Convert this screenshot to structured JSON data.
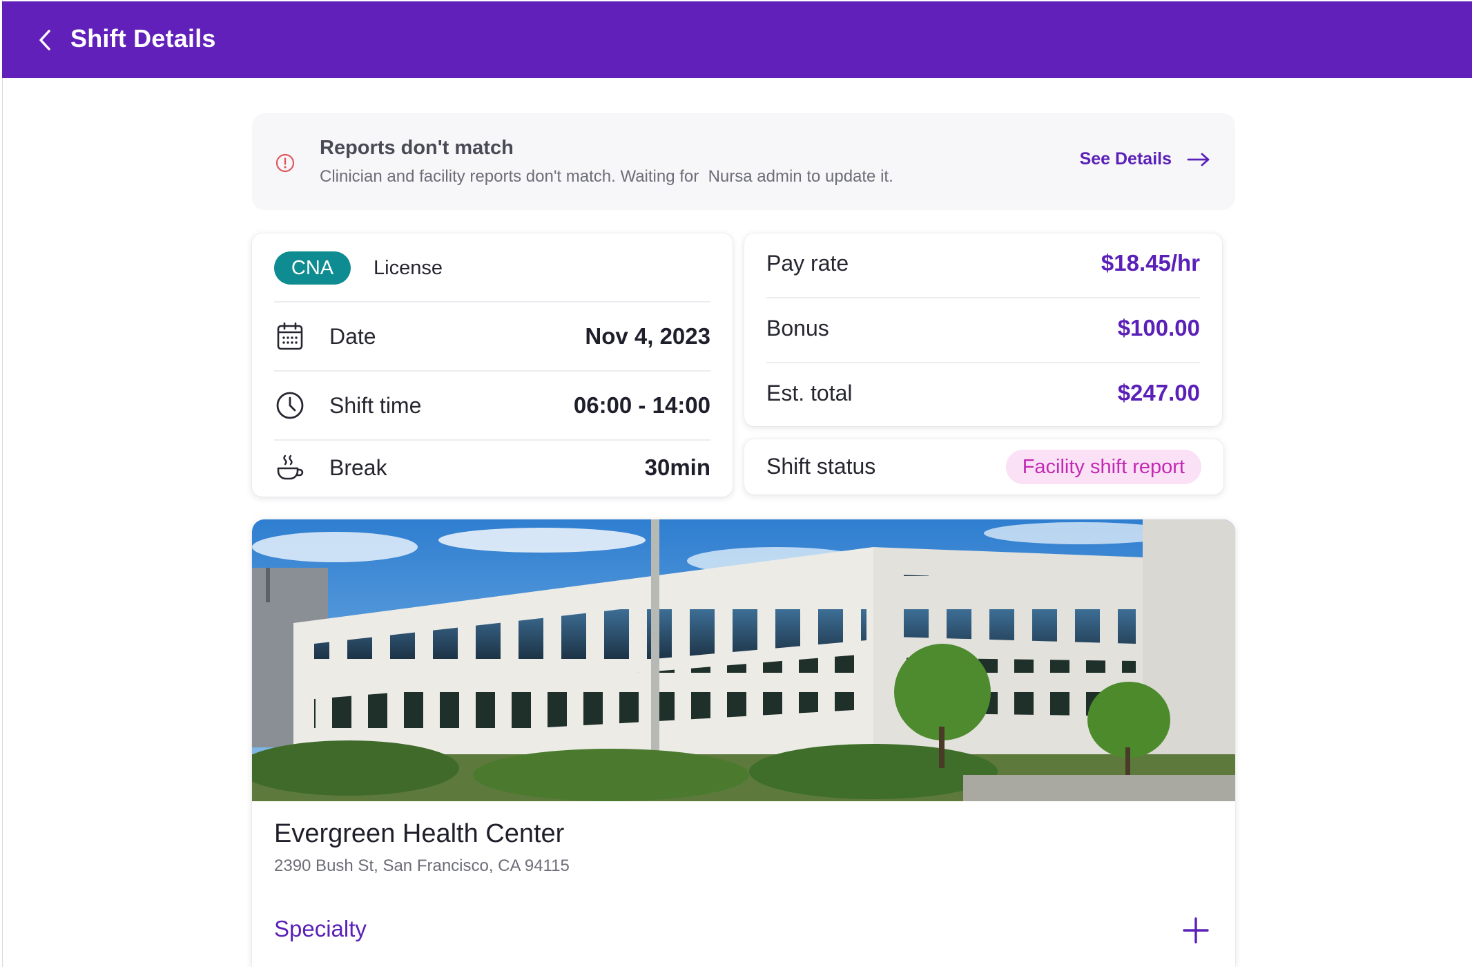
{
  "header": {
    "title": "Shift Details",
    "back_icon": "chevron-left-icon",
    "background": "#6220bb"
  },
  "alert": {
    "icon": "alert-circle-icon",
    "title": "Reports don't match",
    "message": "Clinician and facility reports don't match. Waiting for  Nursa admin to update it.",
    "action_label": "See Details",
    "action_icon": "arrow-right-icon",
    "accent": "#5a20b8",
    "icon_color": "#e0575e"
  },
  "shift": {
    "license_badge": "CNA",
    "license_label": "License",
    "badge_color": "#0f8c91",
    "rows": [
      {
        "icon": "calendar-icon",
        "label": "Date",
        "value": "Nov 4, 2023"
      },
      {
        "icon": "clock-icon",
        "label": "Shift time",
        "value": "06:00 - 14:00"
      },
      {
        "icon": "coffee-cup-icon",
        "label": "Break",
        "value": "30min"
      }
    ]
  },
  "pay": {
    "rows": [
      {
        "label": "Pay rate",
        "value": "$18.45/hr"
      },
      {
        "label": "Bonus",
        "value": "$100.00"
      },
      {
        "label": "Est. total",
        "value": "$247.00"
      }
    ],
    "value_color": "#5a20b8"
  },
  "status": {
    "label": "Shift status",
    "badge": "Facility shift report",
    "badge_bg": "#fbe1f6",
    "badge_color": "#c22ab3"
  },
  "facility": {
    "image": "facility-building-photo",
    "name": "Evergreen Health Center",
    "address": "2390 Bush St, San Francisco, CA 94115",
    "specialty_label": "Specialty",
    "expand_icon": "plus-icon"
  }
}
